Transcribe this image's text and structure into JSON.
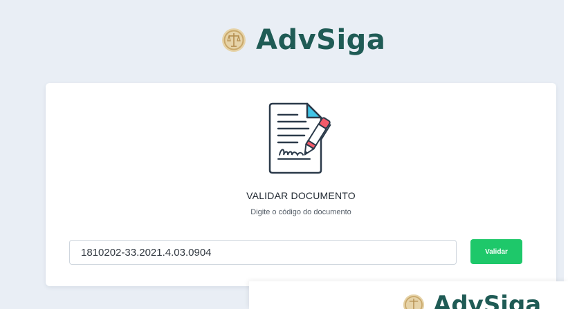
{
  "brand": {
    "name": "AdvSiga",
    "logo_icon": "scales-medallion-icon",
    "color": "#1f5b55",
    "logo_color": "#c9a86a"
  },
  "card": {
    "illustration_icon": "signed-document-icon",
    "title": "VALIDAR DOCUMENTO",
    "subtitle": "Digite o código do documento"
  },
  "form": {
    "code_value": "1810202-33.2021.4.03.0904",
    "validate_label": "Validar",
    "validate_color": "#1ec86a"
  },
  "overlay": {
    "brand_name": "AdvSiga"
  },
  "colors": {
    "background": "#e9eef5",
    "card": "#ffffff"
  }
}
